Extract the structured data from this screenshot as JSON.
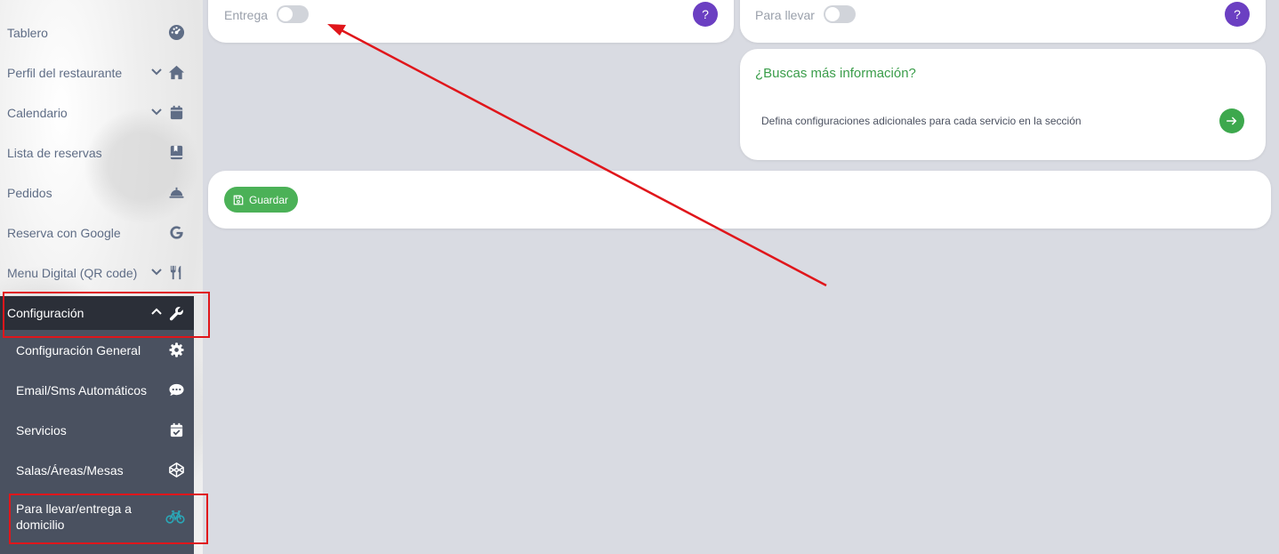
{
  "sidebar": {
    "items": [
      {
        "label": "Tablero",
        "icon": "dashboard-gauge-icon",
        "has_chevron": false
      },
      {
        "label": "Perfil del restaurante",
        "icon": "home-icon",
        "has_chevron": true
      },
      {
        "label": "Calendario",
        "icon": "calendar-icon",
        "has_chevron": true
      },
      {
        "label": "Lista de reservas",
        "icon": "book-icon",
        "has_chevron": false
      },
      {
        "label": "Pedidos",
        "icon": "service-bell-icon",
        "has_chevron": false
      },
      {
        "label": "Reserva con Google",
        "icon": "google-icon",
        "has_chevron": false
      },
      {
        "label": "Menu Digital (QR code)",
        "icon": "utensils-icon",
        "has_chevron": true
      }
    ],
    "config": {
      "label": "Configuración",
      "icon": "wrench-icon",
      "submenu": [
        {
          "label": "Configuración General",
          "icon": "gear-icon"
        },
        {
          "label": "Email/Sms Automáticos",
          "icon": "chat-bubble-icon"
        },
        {
          "label": "Servicios",
          "icon": "calendar-check-icon"
        },
        {
          "label": "Salas/Áreas/Mesas",
          "icon": "codepen-cube-icon"
        },
        {
          "label": "Para llevar/entrega a domicilio",
          "icon": "bicycle-icon",
          "icon_color": "#2aa8b8"
        }
      ]
    }
  },
  "main": {
    "delivery": {
      "label": "Entrega",
      "enabled": false,
      "help": "?"
    },
    "takeaway": {
      "label": "Para llevar",
      "enabled": false,
      "help": "?"
    },
    "info": {
      "title": "¿Buscas más información?",
      "text": "Defina configuraciones adicionales para cada servicio en la sección"
    },
    "save_label": "Guardar"
  },
  "colors": {
    "accent_purple": "#6b3fc2",
    "accent_green": "#3da84d",
    "annotation_red": "#e0161b"
  }
}
